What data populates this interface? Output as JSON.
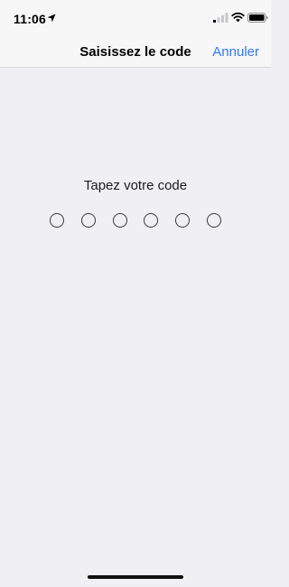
{
  "status_bar": {
    "time": "11:06",
    "icons": [
      "location-arrow-icon",
      "cellular-signal-icon",
      "wifi-icon",
      "battery-icon"
    ]
  },
  "nav": {
    "title": "Saisissez le code",
    "cancel_label": "Annuler"
  },
  "passcode": {
    "prompt": "Tapez votre code",
    "digit_count": 6,
    "entered_count": 0
  },
  "colors": {
    "accent": "#3478f6",
    "background": "#efeff4",
    "nav_background": "#f7f7f7"
  }
}
